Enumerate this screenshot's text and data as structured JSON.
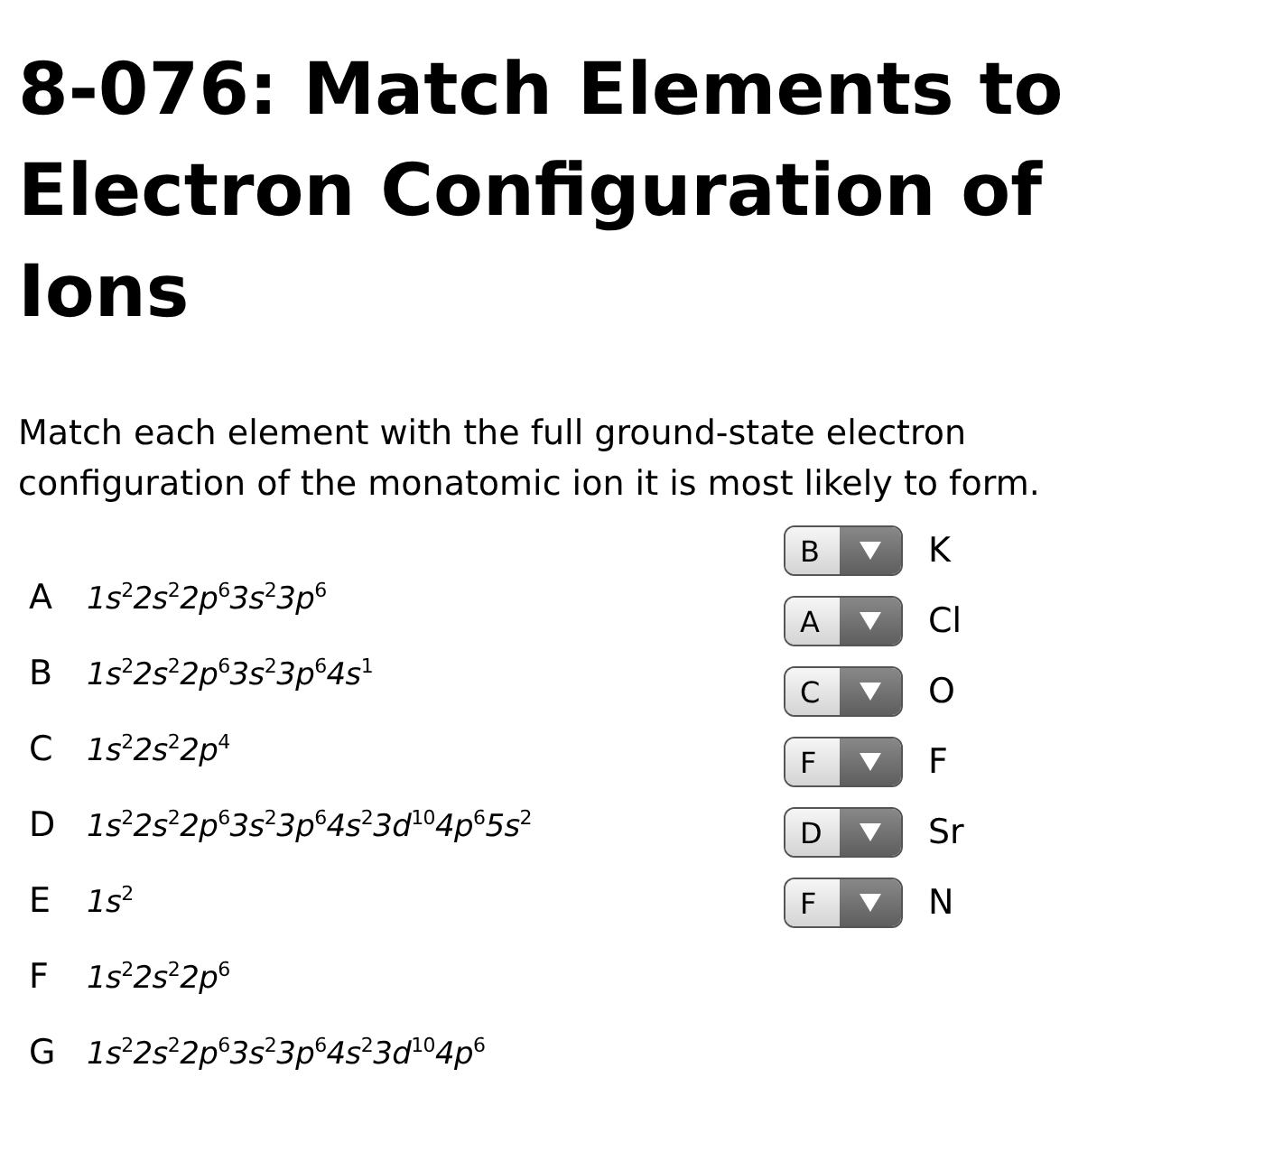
{
  "title": "8-076: Match Elements to Electron Configuration of Ions",
  "instructions": "Match each element with the full ground-state electron configuration of the monatomic ion it is most likely to form.",
  "options": [
    {
      "letter": "A",
      "configuration": "1s$^{2}$2s$^{2}$2p$^{6}$3s$^{2}$3p$^{6}$"
    },
    {
      "letter": "B",
      "configuration": "1s$^{2}$2s$^{2}$2p$^{6}$3s$^{2}$3p$^{6}$4s$^{1}$"
    },
    {
      "letter": "C",
      "configuration": "1s$^{2}$2s$^{2}$2p$^{4}$"
    },
    {
      "letter": "D",
      "configuration": "1s$^{2}$2s$^{2}$2p$^{6}$3s$^{2}$3p$^{6}$4s$^{2}$3d$^{10}$4p$^{6}$5s$^{2}$"
    },
    {
      "letter": "E",
      "configuration": "1s$^{2}$"
    },
    {
      "letter": "F",
      "configuration": "1s$^{2}$2s$^{2}$2p$^{6}$"
    },
    {
      "letter": "G",
      "configuration": "1s$^{2}$2s$^{2}$2p$^{6}$3s$^{2}$3p$^{6}$4s$^{2}$3d$^{10}$4p$^{6}$"
    }
  ],
  "elements": [
    {
      "answer": "B",
      "element": "K"
    },
    {
      "answer": "A",
      "element": "Cl"
    },
    {
      "answer": "C",
      "element": "O"
    },
    {
      "answer": "F",
      "element": "F"
    },
    {
      "answer": "D",
      "element": "Sr"
    },
    {
      "answer": "F",
      "element": "N"
    }
  ]
}
